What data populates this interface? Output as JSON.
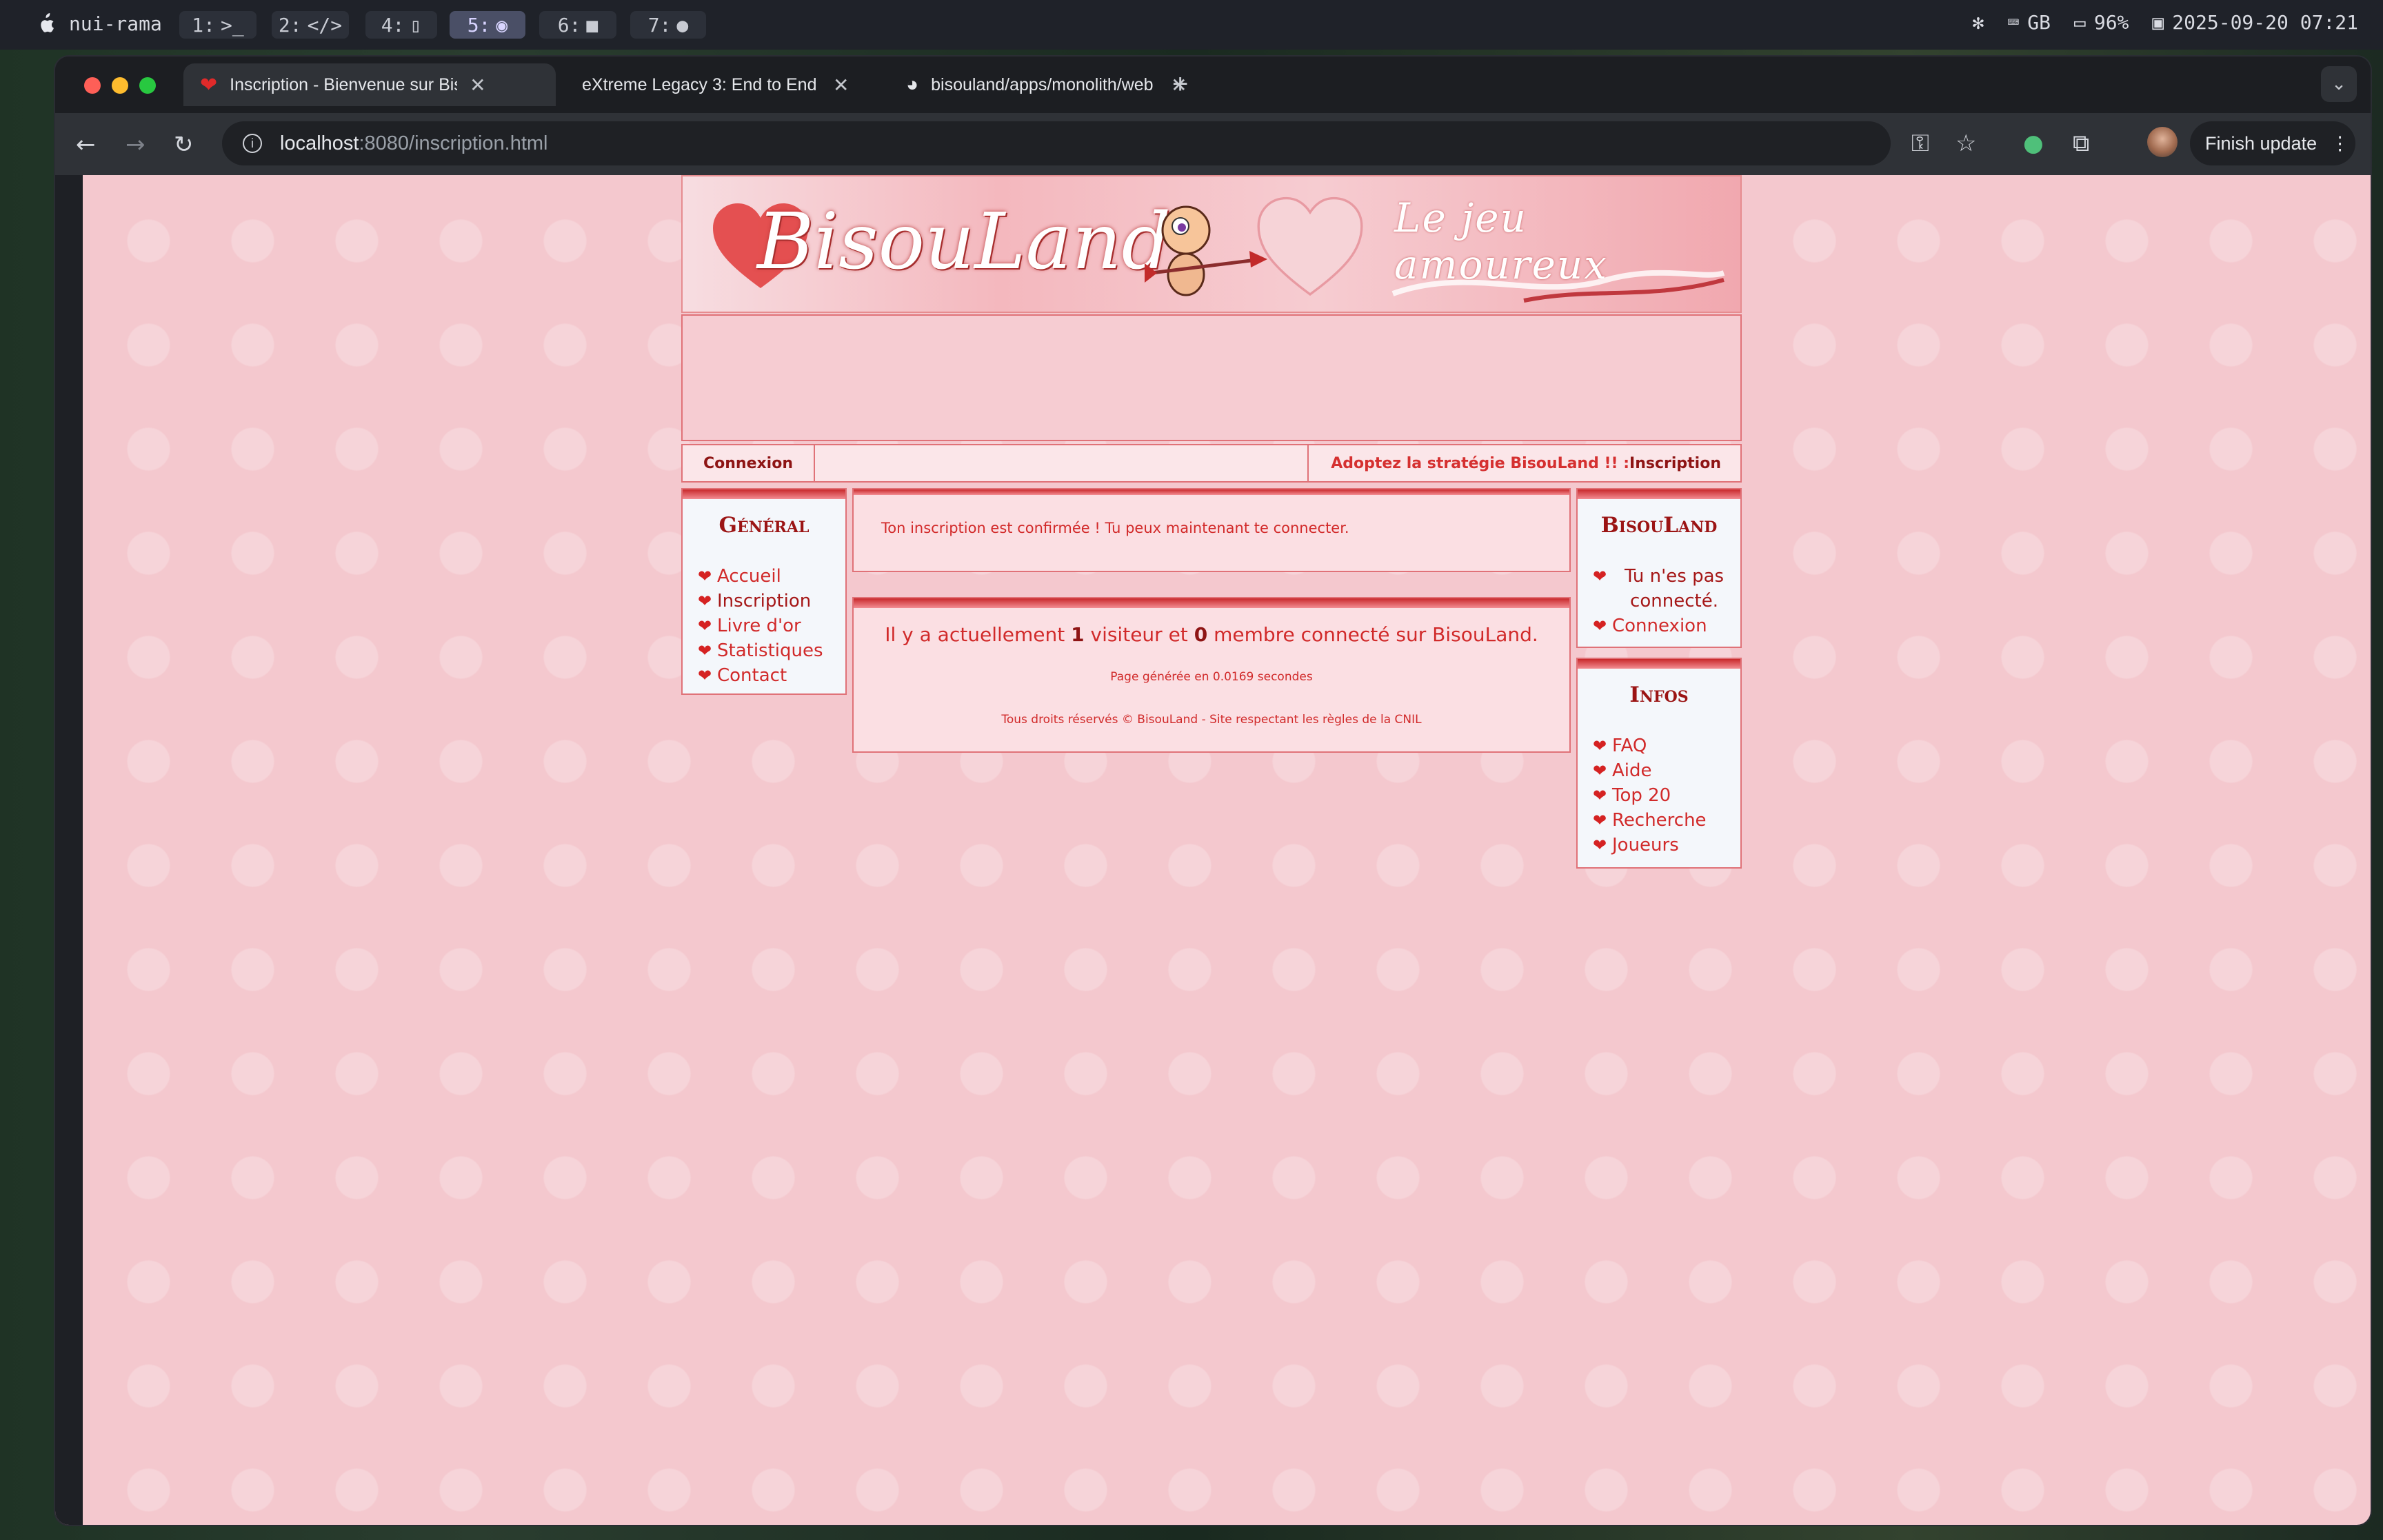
{
  "menubar": {
    "host": "nui-rama",
    "workspaces": [
      {
        "label": "1:",
        "icon": "terminal-icon"
      },
      {
        "label": "2:",
        "icon": "code-icon"
      },
      {
        "label": "4:",
        "icon": "phone-icon"
      },
      {
        "label": "5:",
        "icon": "browser-icon",
        "active": true
      },
      {
        "label": "6:",
        "icon": "chat-icon"
      },
      {
        "label": "7:",
        "icon": "music-icon"
      }
    ],
    "keyboard": "GB",
    "battery": "96%",
    "datetime": "2025-09-20 07:21"
  },
  "browser": {
    "tabs": [
      {
        "title": "Inscription - Bienvenue sur BisouLand",
        "active": true,
        "icon": "heart-favicon"
      },
      {
        "title": "eXtreme Legacy 3: End to End",
        "active": false
      },
      {
        "title": "bisouland/apps/monolith/web",
        "active": false,
        "icon": "github-icon"
      }
    ],
    "url_host": "localhost",
    "url_path": ":8080/inscription.html",
    "finish_update": "Finish update"
  },
  "page": {
    "logo": "BisouLand",
    "tagline": "Le jeu amoureux",
    "topbar": {
      "connexion": "Connexion",
      "promo_prefix": "Adoptez la stratégie BisouLand !! : ",
      "promo_link": "Inscription"
    },
    "left_menu": {
      "title": "Général",
      "items": [
        "Accueil",
        "Inscription",
        "Livre d'or",
        "Statistiques",
        "Contact"
      ]
    },
    "message": "Ton inscription est confirmée ! Tu peux maintenant te connecter.",
    "stats": {
      "prefix": "Il y a actuellement ",
      "visitors": "1",
      "middle": " visiteur et ",
      "members": "0",
      "suffix": " membre connecté sur BisouLand."
    },
    "generated": "Page générée en 0.0169 secondes",
    "copyright": "Tous droits réservés © BisouLand - Site respectant les règles de la CNIL",
    "right_bisouland": {
      "title": "BisouLand",
      "status": "Tu n'es pas connecté.",
      "login_link": "Connexion"
    },
    "right_infos": {
      "title": "Infos",
      "items": [
        "FAQ",
        "Aide",
        "Top 20",
        "Recherche",
        "Joueurs"
      ]
    }
  }
}
